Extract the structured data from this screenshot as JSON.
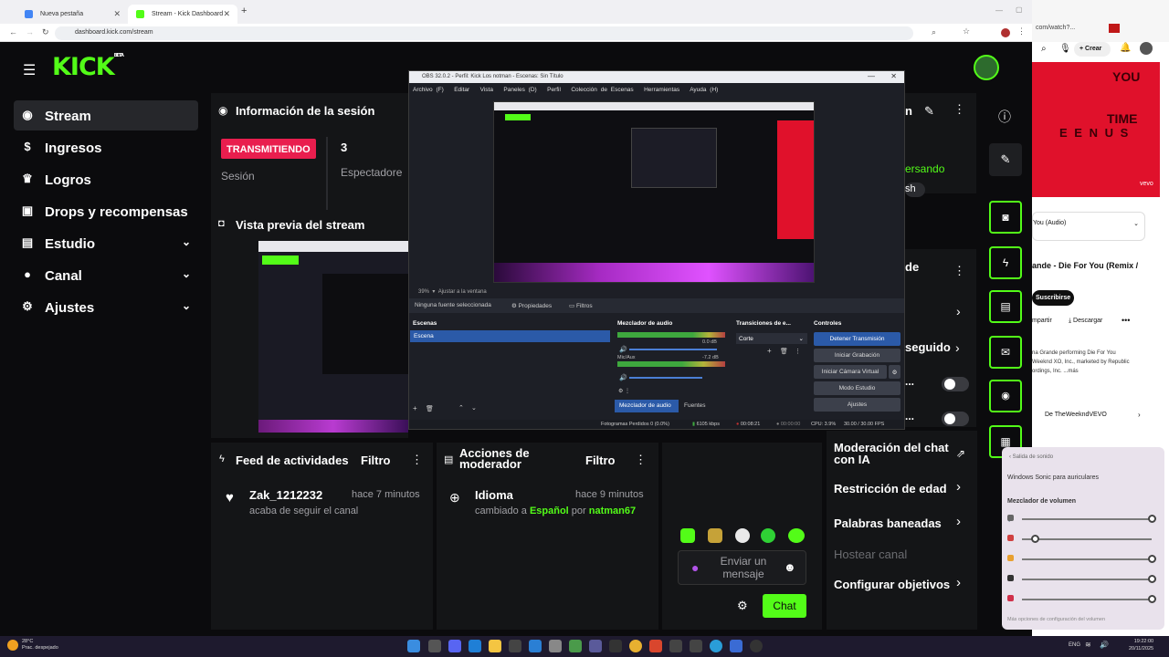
{
  "browser": {
    "tabs": [
      {
        "label": "Nueva pestaña",
        "favicon_color": "#4285f4"
      },
      {
        "label": "Stream - Kick Dashboard",
        "favicon_color": "#53fc18"
      }
    ],
    "url": "dashboard.kick.com/stream"
  },
  "kick": {
    "logo": "KICK",
    "logo_sup": "BETA",
    "nav": [
      {
        "label": "Stream",
        "icon": "broadcast-icon"
      },
      {
        "label": "Ingresos",
        "icon": "dollar-icon"
      },
      {
        "label": "Logros",
        "icon": "trophy-icon"
      },
      {
        "label": "Drops y recompensas",
        "icon": "gift-icon"
      },
      {
        "label": "Estudio",
        "icon": "film-icon"
      },
      {
        "label": "Canal",
        "icon": "person-icon"
      },
      {
        "label": "Ajustes",
        "icon": "gear-icon"
      }
    ],
    "session": {
      "title": "Información de la sesión",
      "status_badge": "TRANSMITIENDO",
      "status_label": "Sesión",
      "viewers_value": "3",
      "viewers_label": "Espectadore"
    },
    "preview": {
      "title": "Vista previa del stream"
    },
    "feed": {
      "title": "Feed de actividades",
      "filter": "Filtro",
      "item_user": "Zak_1212232",
      "item_time": "hace 7 minutos",
      "item_text": "acaba de seguir el canal"
    },
    "mod": {
      "title": "Acciones de moderador",
      "filter": "Filtro",
      "item_title": "Idioma",
      "item_time": "hace 9 minutos",
      "item_prefix": "cambiado a",
      "item_lang": "Español",
      "item_by": "por",
      "item_user": "natman67"
    },
    "chat": {
      "placeholder": "Enviar un mensaje",
      "send_label": "Chat",
      "partial_1": "ersando",
      "partial_2": "sh"
    },
    "right_panel": {
      "partial_title": "de",
      "partial_follow": "seguido",
      "items": [
        "Moderación del chat con IA",
        "Restricción de edad",
        "Palabras baneadas",
        "Hostear canal",
        "Configurar objetivos"
      ]
    },
    "accent": "#53fc18",
    "live_color": "#e91e4e"
  },
  "obs": {
    "title": "OBS 32.0.2 - Perfil: Kick Los notman - Escenas: Sin Título",
    "menu": [
      "Archivo (F)",
      "Editar",
      "Vista",
      "Paneles (D)",
      "Perfil",
      "Colección de Escenas",
      "Herramientas",
      "Ayuda (H)"
    ],
    "zoom": "39%",
    "fit": "Ajustar a la ventana",
    "no_source": "Ninguna fuente seleccionada",
    "properties": "Propiedades",
    "filters": "Filtros",
    "scenes_title": "Escenas",
    "scene_item": "Escena",
    "mixer_title": "Mezclador de audio",
    "mixer_db1": "0.0 dB",
    "mixer_label2": "Mic/Aux",
    "mixer_db2": "-7.2 dB",
    "mixer_tab": "Mezclador de audio",
    "sources_tab": "Fuentes",
    "transitions_title": "Transiciones de e...",
    "transition_value": "Corte",
    "controls_title": "Controles",
    "controls": [
      "Detener Transmisión",
      "Iniciar Grabación",
      "Iniciar Cámara Virtual",
      "Modo Estudio",
      "Ajustes"
    ],
    "status": {
      "dropped": "Fotogramas Perdidos 0 (0.0%)",
      "bitrate": "6105 kbps",
      "live_time": "00:08:21",
      "rec_time": "00:00:00",
      "cpu": "CPU: 3.9%",
      "fps": "30.00 / 30.00 FPS"
    }
  },
  "youtube": {
    "create": "Crear",
    "title": "ande - Die For You (Remix /",
    "audio_option": "You (Audio)",
    "subscribe": "Suscribirse",
    "share": "mpartir",
    "download": "Descargar",
    "desc_1": "na Grande performing Die For You",
    "desc_2": "Weeknd XO, Inc., marketed by Republic",
    "desc_3": "ordings, Inc. ...más",
    "channel": "De TheWeekndVEVO",
    "vevo": "vevo",
    "art_words": [
      "YOU",
      "TIME",
      "E E N U S"
    ]
  },
  "volume_mixer": {
    "output": "Salida de sonido",
    "device": "Windows Sonic para auriculares",
    "title": "Mezclador de volumen",
    "footer": "Más opciones de configuración del volumen",
    "levels": [
      1.0,
      0.1,
      1.0,
      1.0,
      1.0
    ]
  },
  "taskbar": {
    "weather_temp": "28°C",
    "weather_desc": "Prac. despejado",
    "lang": "ENG",
    "time": "19:22:00",
    "date": "20/11/2025"
  }
}
